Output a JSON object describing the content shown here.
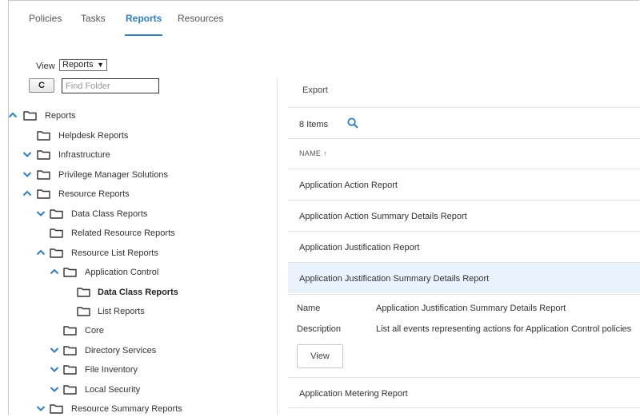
{
  "tabs": [
    {
      "label": "Policies"
    },
    {
      "label": "Tasks"
    },
    {
      "label": "Reports"
    },
    {
      "label": "Resources"
    }
  ],
  "view": {
    "label": "View",
    "selected": "Reports"
  },
  "find": {
    "placeholder": "Find Folder",
    "refresh_glyph": "C"
  },
  "tree": [
    {
      "label": "Reports",
      "chevron": "up",
      "bold": false
    },
    {
      "label": "Helpdesk Reports",
      "chevron": "none",
      "bold": false
    },
    {
      "label": "Infrastructure",
      "chevron": "down",
      "bold": false
    },
    {
      "label": "Privilege Manager Solutions",
      "chevron": "down",
      "bold": false
    },
    {
      "label": "Resource Reports",
      "chevron": "up",
      "bold": false
    },
    {
      "label": "Data Class Reports",
      "chevron": "down",
      "bold": false
    },
    {
      "label": "Related Resource Reports",
      "chevron": "none",
      "bold": false
    },
    {
      "label": "Resource List Reports",
      "chevron": "up",
      "bold": false
    },
    {
      "label": "Application Control",
      "chevron": "up",
      "bold": false
    },
    {
      "label": "Data Class Reports",
      "chevron": "none",
      "bold": true
    },
    {
      "label": "List Reports",
      "chevron": "none",
      "bold": false
    },
    {
      "label": "Core",
      "chevron": "none",
      "bold": false
    },
    {
      "label": "Directory Services",
      "chevron": "down",
      "bold": false
    },
    {
      "label": "File Inventory",
      "chevron": "down",
      "bold": false
    },
    {
      "label": "Local Security",
      "chevron": "down",
      "bold": false
    },
    {
      "label": "Resource Summary Reports",
      "chevron": "down",
      "bold": false
    }
  ],
  "list": {
    "export_label": "Export",
    "items_count": "8 Items",
    "column_header": "NAME",
    "sort_arrow": "↑",
    "rows": [
      {
        "label": "Application Action Report",
        "selected": false
      },
      {
        "label": "Application Action Summary Details Report",
        "selected": false
      },
      {
        "label": "Application Justification Report",
        "selected": false
      },
      {
        "label": "Application Justification Summary Details Report",
        "selected": true
      },
      {
        "label": "Application Metering Report",
        "selected": false
      }
    ],
    "detail": {
      "name_key": "Name",
      "name_value": "Application Justification Summary Details Report",
      "description_key": "Description",
      "description_value": "List all events representing actions for Application Control policies",
      "view_button": "View"
    }
  },
  "colors": {
    "accent": "#2a7fd4",
    "selected_row": "#eaf3fb",
    "divider": "#e2e2e2"
  }
}
